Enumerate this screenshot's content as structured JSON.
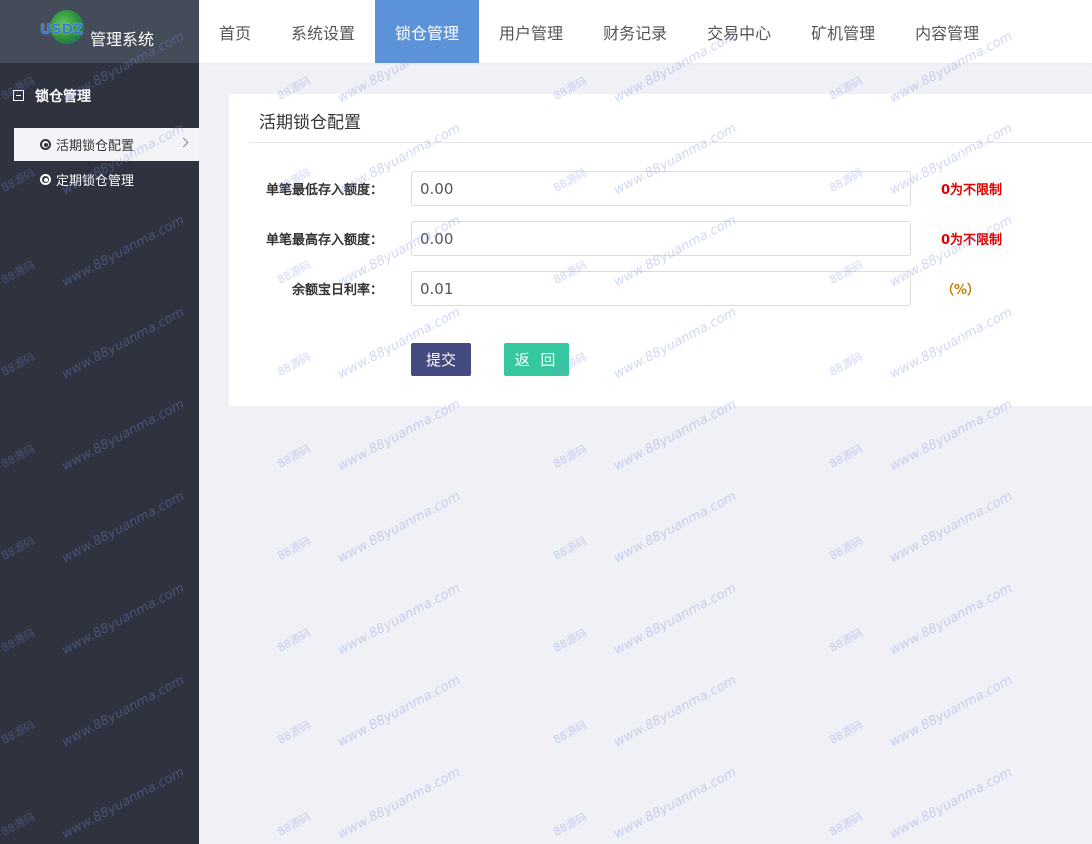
{
  "brand": {
    "logo_text": "USDZ",
    "system_name": "管理系统"
  },
  "topnav": {
    "items": [
      {
        "label": "首页",
        "active": false
      },
      {
        "label": "系统设置",
        "active": false
      },
      {
        "label": "锁仓管理",
        "active": true
      },
      {
        "label": "用户管理",
        "active": false
      },
      {
        "label": "财务记录",
        "active": false
      },
      {
        "label": "交易中心",
        "active": false
      },
      {
        "label": "矿机管理",
        "active": false
      },
      {
        "label": "内容管理",
        "active": false
      }
    ]
  },
  "sidebar": {
    "group_label": "锁仓管理",
    "items": [
      {
        "label": "活期锁仓配置",
        "active": true
      },
      {
        "label": "定期锁仓管理",
        "active": false
      }
    ]
  },
  "card": {
    "title": "活期锁仓配置",
    "fields": [
      {
        "label": "单笔最低存入额度：",
        "value": "0.00",
        "hint": "0为不限制",
        "hint_color": "#e00000"
      },
      {
        "label": "单笔最高存入额度：",
        "value": "0.00",
        "hint": "0为不限制",
        "hint_color": "#e00000"
      },
      {
        "label": "余额宝日利率：",
        "value": "0.01",
        "hint": "（%）",
        "hint_color": "#c08000"
      }
    ],
    "submit_label": "提交",
    "back_label": "返 回"
  },
  "watermark": {
    "url_text": "www.88yuanma.com",
    "cn_text": "88源码"
  },
  "colors": {
    "sidebar_bg": "#2e333f",
    "logo_bg": "#444b59",
    "nav_active": "#5b92d8",
    "submit_btn": "#444a80",
    "back_btn": "#35c8a0"
  }
}
